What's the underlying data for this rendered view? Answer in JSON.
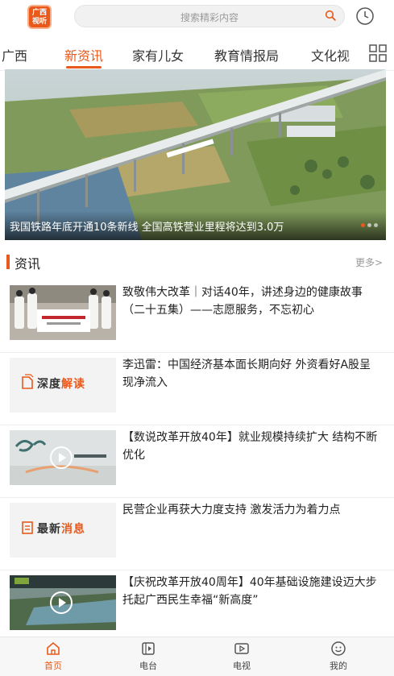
{
  "header": {
    "logo_text": "广西视听",
    "search_placeholder": "搜索精彩内容"
  },
  "tabs": [
    {
      "label": "广西",
      "active": false
    },
    {
      "label": "新资讯",
      "active": true
    },
    {
      "label": "家有儿女",
      "active": false
    },
    {
      "label": "教育情报局",
      "active": false
    },
    {
      "label": "文化视",
      "active": false
    }
  ],
  "banner": {
    "caption": "我国铁路年底开通10条新线 全国高铁营业里程将达到3.0万"
  },
  "section": {
    "title": "资讯",
    "more": "更多>"
  },
  "news": [
    {
      "title": "致敬伟大改革｜对话40年，讲述身边的健康故事（二十五集）——志愿服务，不忘初心",
      "thumb": "photo",
      "video": false
    },
    {
      "title": "李迅雷：中国经济基本面长期向好 外资看好A股呈现净流入",
      "thumb": "badge",
      "badge_a": "深度",
      "badge_b": "解读",
      "video": false
    },
    {
      "title": "【数说改革开放40年】就业规模持续扩大 结构不断优化",
      "thumb": "photo",
      "video": true
    },
    {
      "title": "民营企业再获大力度支持 激发活力为着力点",
      "thumb": "badge",
      "badge_a": "最新",
      "badge_b": "消息",
      "video": false
    },
    {
      "title": "【庆祝改革开放40周年】40年基础设施建设迈大步 托起广西民生幸福“新高度”",
      "thumb": "photo",
      "video": true
    }
  ],
  "bottom_nav": [
    {
      "label": "首页",
      "icon": "home-icon",
      "active": true
    },
    {
      "label": "电台",
      "icon": "radio-icon",
      "active": false
    },
    {
      "label": "电视",
      "icon": "tv-icon",
      "active": false
    },
    {
      "label": "我的",
      "icon": "profile-icon",
      "active": false
    }
  ],
  "colors": {
    "accent": "#e8591b"
  }
}
